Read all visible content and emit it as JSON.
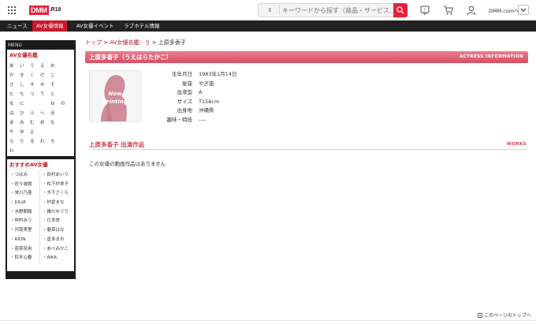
{
  "header": {
    "logo_text": "DMM",
    "logo_suffix": ".R18",
    "search_placeholder": "キーワードから探す（商品・サービス...",
    "account_label": "DMM.comへ"
  },
  "nav": {
    "items": [
      {
        "label": "ニュース"
      },
      {
        "label": "AV女優情報"
      },
      {
        "label": "AV女優イベント"
      },
      {
        "label": "ラブホテル情報"
      }
    ]
  },
  "sidebar": {
    "menu_title": "MENU",
    "kana_heading": "AV女優名鑑",
    "kana": [
      "あ",
      "い",
      "う",
      "え",
      "お",
      "",
      "か",
      "き",
      "く",
      "け",
      "こ",
      "",
      "さ",
      "し",
      "す",
      "せ",
      "そ",
      "",
      "た",
      "ち",
      "つ",
      "て",
      "と",
      "",
      "な",
      "に",
      "",
      "",
      "ね",
      "の",
      "は",
      "ひ",
      "ふ",
      "へ",
      "ほ",
      "",
      "ま",
      "み",
      "む",
      "め",
      "も",
      "",
      "や",
      "ゆ",
      "よ",
      "",
      "",
      "",
      "ら",
      "り",
      "る",
      "れ",
      "ろ",
      "",
      "わ",
      "",
      "",
      "",
      "",
      ""
    ],
    "recommend_heading": "おすすめAV女優",
    "recommend": [
      "・つぼみ",
      "・鈴村あいり",
      "・佐々波綾",
      "・松下紗栄子",
      "・栄川乃亜",
      "・木下さくら",
      "・JULIA",
      "・紗倉まな",
      "・水野朝陽",
      "・推川ゆうり",
      "・仲村みう",
      "・辻本杏",
      "・河南実里",
      "・春菜はな",
      "・RION",
      "・倉多まお",
      "・若菜奈央",
      "・あべみかこ",
      "・鈴木心春",
      "・AIKA"
    ]
  },
  "breadcrumb": {
    "home": "トップ",
    "sep1": " > ",
    "index": "AV女優名鑑：う",
    "sep2": " > ",
    "current": "上原多香子"
  },
  "actress": {
    "title": "上原多香子（うえはらたかこ）",
    "section_label": "ACTRESS INFORMATION",
    "photo_text_line1": "Now",
    "photo_text_line2": "Printing",
    "profile": [
      {
        "label": "生年月日",
        "value": "1983年1月14日"
      },
      {
        "label": "星座",
        "value": "やぎ座"
      },
      {
        "label": "血液型",
        "value": "A"
      },
      {
        "label": "サイズ",
        "value": "T156cm"
      },
      {
        "label": "出身地",
        "value": "沖縄県"
      },
      {
        "label": "趣味・特技",
        "value": "----"
      }
    ]
  },
  "works": {
    "title": "上原多香子 出演作品",
    "section_label": "WORKS",
    "empty_message": "この女優の動画作品はありません"
  },
  "footer": {
    "page_top": "このページのトップへ"
  },
  "colors": {
    "brand_red": "#e6203a",
    "nav_active": "#c8192f",
    "title_bar": "#d94d63",
    "sidebar_bg": "#1c1c1c"
  }
}
